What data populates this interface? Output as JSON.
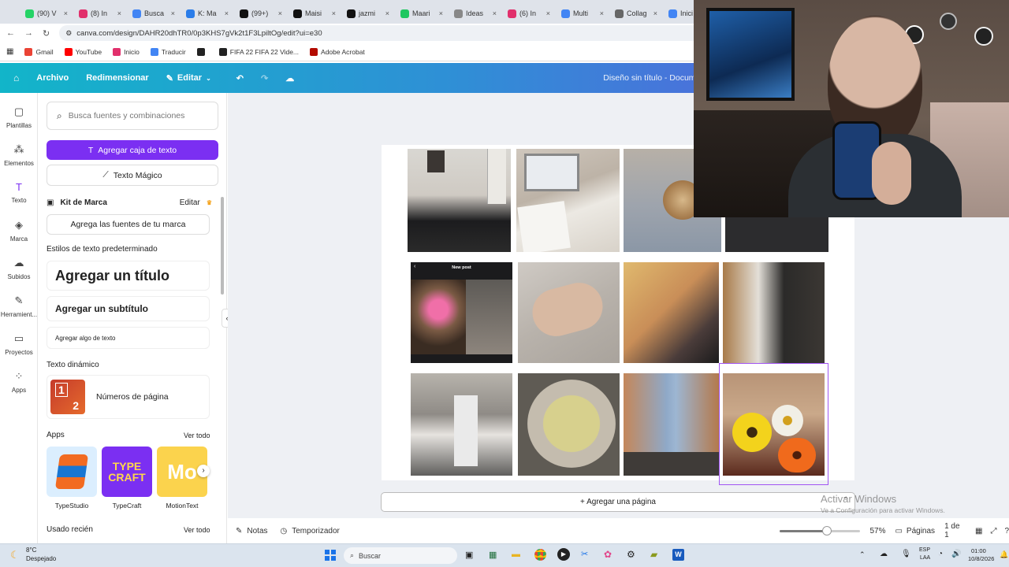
{
  "browser": {
    "tabs": [
      {
        "label": "(90) V",
        "color": "#25d366"
      },
      {
        "label": "(8) In",
        "color": "#e1306c"
      },
      {
        "label": "Busca",
        "color": "#4285f4"
      },
      {
        "label": "K: Ma",
        "color": "#2b7de9"
      },
      {
        "label": "(99+)",
        "color": "#111111"
      },
      {
        "label": "Maisi",
        "color": "#111111"
      },
      {
        "label": "jazmi",
        "color": "#111111"
      },
      {
        "label": "Maari",
        "color": "#1ec760"
      },
      {
        "label": "Ideas",
        "color": "#888888"
      },
      {
        "label": "(6) In",
        "color": "#e1306c"
      },
      {
        "label": "Multi",
        "color": "#4285f4"
      },
      {
        "label": "Collag",
        "color": "#666666"
      },
      {
        "label": "Inici",
        "color": "#4285f4"
      }
    ],
    "url": "canva.com/design/DAHR20dhTR0/0p3KHS7gVk2t1F3LpiltOg/edit?ui=e30",
    "bookmarks": [
      {
        "label": "Gmail",
        "color": "#ea4335"
      },
      {
        "label": "YouTube",
        "color": "#ff0000"
      },
      {
        "label": "Inicio",
        "color": "#e1306c"
      },
      {
        "label": "Traducir",
        "color": "#4285f4"
      },
      {
        "label": "",
        "color": "#222222"
      },
      {
        "label": "FIFA 22 FIFA 22 Vide...",
        "color": "#222222"
      },
      {
        "label": "Adobe Acrobat",
        "color": "#b30b00"
      }
    ]
  },
  "canva": {
    "menu": {
      "archivo": "Archivo",
      "redimensionar": "Redimensionar",
      "editar": "Editar"
    },
    "doc_title": "Diseño sin título - Document",
    "rail": [
      {
        "label": "Plantillas",
        "icon": "▢"
      },
      {
        "label": "Elementos",
        "icon": "⁂"
      },
      {
        "label": "Texto",
        "icon": "T"
      },
      {
        "label": "Marca",
        "icon": "◈"
      },
      {
        "label": "Subidos",
        "icon": "☁"
      },
      {
        "label": "Herramient...",
        "icon": "✎"
      },
      {
        "label": "Proyectos",
        "icon": "▭"
      },
      {
        "label": "Apps",
        "icon": "⁘"
      }
    ],
    "panel": {
      "search_placeholder": "Busca fuentes y combinaciones",
      "add_textbox": "Agregar caja de texto",
      "magic_text": "Texto Mágico",
      "brand_kit": "Kit de Marca",
      "brand_edit": "Editar",
      "brand_fonts": "Agrega las fuentes de tu marca",
      "default_styles": "Estilos de texto predeterminado",
      "add_title": "Agregar un título",
      "add_subtitle": "Agregar un subtítulo",
      "add_body": "Agregar algo de texto",
      "dynamic_text": "Texto dinámico",
      "page_numbers": "Números de página",
      "apps_heading": "Apps",
      "see_all": "Ver todo",
      "apps": [
        {
          "label": "TypeStudio"
        },
        {
          "label": "TypeCraft"
        },
        {
          "label": "MotionText"
        }
      ],
      "recent": "Usado recién",
      "recent_see_all": "Ver todo"
    },
    "add_page": "+ Agregar una página",
    "bottom": {
      "notes": "Notas",
      "timer": "Temporizador",
      "zoom": "57%",
      "zoom_level": 0.57,
      "pages": "Páginas",
      "page_count": "1 de 1"
    },
    "new_post_label": "New post",
    "watermark_title": "Activar Windows",
    "watermark_sub": "Ve a Configuración para activar Windows."
  },
  "taskbar": {
    "weather_temp": "8°C",
    "weather_desc": "Despejado",
    "search": "Buscar",
    "lang1": "ESP",
    "lang2": "LAA",
    "time": "01:00",
    "date": "10/8/2026"
  }
}
